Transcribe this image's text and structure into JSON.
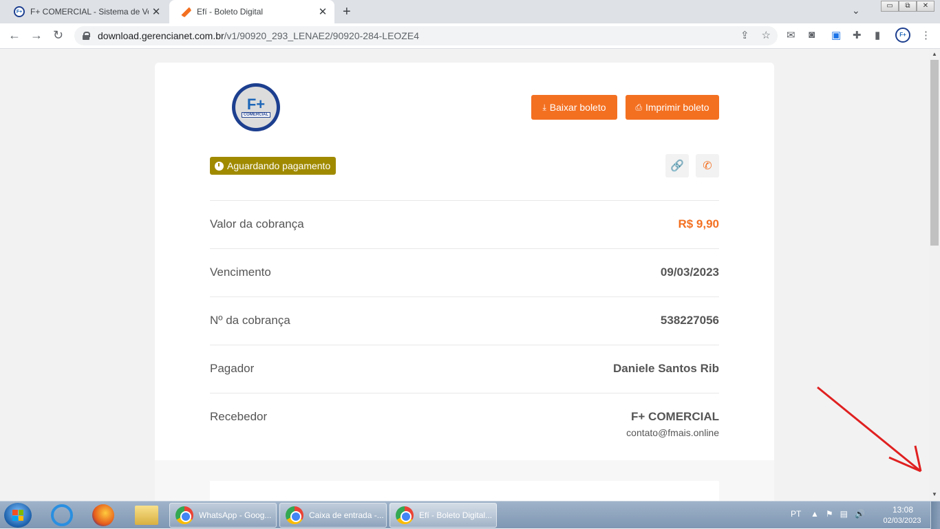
{
  "tabs": [
    {
      "title": "F+ COMERCIAL - Sistema de Vendas",
      "close": "✕"
    },
    {
      "title": "Efí - Boleto Digital",
      "close": "✕"
    }
  ],
  "window_controls": {
    "minimize": "▭",
    "restore": "⧉",
    "close": "✕"
  },
  "toolbar": {
    "url_host": "download.gerencianet.com.br",
    "url_path": "/v1/90920_293_LENAE2/90920-284-LEOZE4"
  },
  "page": {
    "logo_text": "F+",
    "logo_subtext": "COMERCIAL",
    "download_button": "Baixar boleto",
    "print_button": "Imprimir boleto",
    "status_badge": "Aguardando pagamento",
    "rows": [
      {
        "label": "Valor da cobrança",
        "value": "R$ 9,90"
      },
      {
        "label": "Vencimento",
        "value": "09/03/2023"
      },
      {
        "label": "Nº da cobrança",
        "value": "538227056"
      },
      {
        "label": "Pagador",
        "value": "Daniele Santos Rib"
      },
      {
        "label": "Recebedor",
        "value": "F+ COMERCIAL",
        "sub": "contato@fmais.online"
      }
    ],
    "accent_color": "#f37021",
    "status_color": "#a08a00"
  },
  "taskbar": {
    "tasks": [
      {
        "label": "WhatsApp - Goog..."
      },
      {
        "label": "Caixa de entrada -..."
      },
      {
        "label": "Efí - Boleto Digital..."
      }
    ],
    "language": "PT",
    "time": "13:08",
    "date": "02/03/2023"
  }
}
